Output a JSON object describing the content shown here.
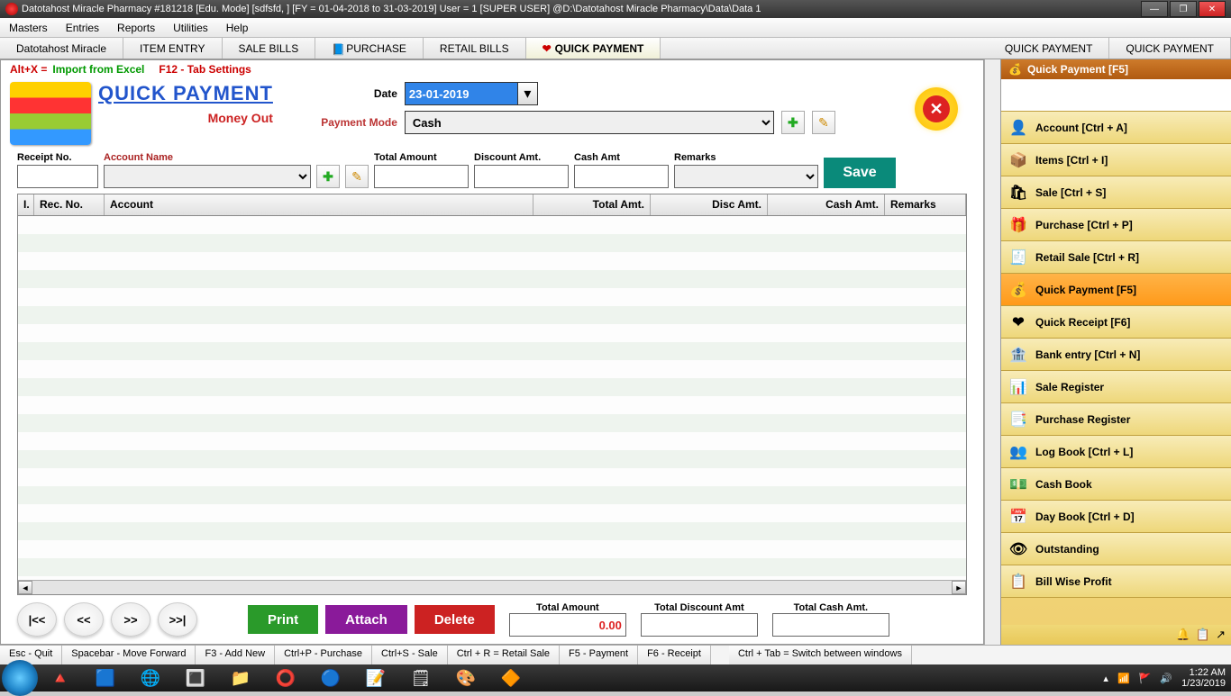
{
  "window": {
    "title": "Datotahost Miracle Pharmacy #181218  [Edu. Mode]  [sdfsfd, ] [FY = 01-04-2018 to 31-03-2019] User = 1 [SUPER USER]  @D:\\Datotahost Miracle Pharmacy\\Data\\Data 1"
  },
  "menubar": [
    "Masters",
    "Entries",
    "Reports",
    "Utilities",
    "Help"
  ],
  "apptabs": [
    {
      "label": "Datotahost Miracle"
    },
    {
      "label": "ITEM ENTRY"
    },
    {
      "label": "SALE BILLS"
    },
    {
      "label": "PURCHASE"
    },
    {
      "label": "RETAIL BILLS"
    },
    {
      "label": "QUICK PAYMENT",
      "active": true
    },
    {
      "label": "QUICK PAYMENT"
    },
    {
      "label": "QUICK PAYMENT"
    }
  ],
  "configbar": {
    "altx": "Alt+X =",
    "import": "Import from Excel",
    "f12": "F12 - Tab Settings"
  },
  "header": {
    "title": "QUICK PAYMENT",
    "subtitle": "Money Out",
    "date_label": "Date",
    "date_value": "23-01-2019",
    "pmode_label": "Payment Mode",
    "pmode_value": "Cash"
  },
  "entry": {
    "receipt_label": "Receipt No.",
    "account_label": "Account Name",
    "total_label": "Total Amount",
    "discount_label": "Discount Amt.",
    "cash_label": "Cash Amt",
    "remarks_label": "Remarks",
    "save": "Save"
  },
  "grid": {
    "cols": [
      "I.",
      "Rec. No.",
      "Account",
      "Total Amt.",
      "Disc Amt.",
      "Cash Amt.",
      "Remarks"
    ]
  },
  "nav": {
    "first": "|<<",
    "prev": "<<",
    "next": ">>",
    "last": ">>|"
  },
  "actions": {
    "print": "Print",
    "attach": "Attach",
    "delete": "Delete"
  },
  "totals": {
    "amount_label": "Total Amount",
    "amount_value": "0.00",
    "discount_label": "Total Discount Amt",
    "discount_value": "",
    "cash_label": "Total Cash Amt.",
    "cash_value": ""
  },
  "shortcuts": [
    "Esc - Quit",
    "Spacebar - Move Forward",
    "F3 - Add New",
    "Ctrl+P - Purchase",
    "Ctrl+S - Sale",
    "Ctrl + R = Retail Sale",
    "F5 - Payment",
    "F6 - Receipt",
    "Ctrl + Tab = Switch between windows"
  ],
  "side": {
    "title": "Quick Payment [F5]",
    "items": [
      {
        "label": "Account [Ctrl + A]",
        "icon": "👤"
      },
      {
        "label": "Items [Ctrl + I]",
        "icon": "📦"
      },
      {
        "label": "Sale [Ctrl + S]",
        "icon": "🛍"
      },
      {
        "label": "Purchase [Ctrl + P]",
        "icon": "🎁"
      },
      {
        "label": "Retail Sale [Ctrl + R]",
        "icon": "🧾"
      },
      {
        "label": "Quick Payment [F5]",
        "icon": "💰",
        "active": true
      },
      {
        "label": "Quick Receipt [F6]",
        "icon": "❤"
      },
      {
        "label": "Bank entry [Ctrl + N]",
        "icon": "🏦"
      },
      {
        "label": "Sale Register",
        "icon": "📊"
      },
      {
        "label": "Purchase Register",
        "icon": "📑"
      },
      {
        "label": "Log Book [Ctrl + L]",
        "icon": "👥"
      },
      {
        "label": "Cash Book",
        "icon": "💵"
      },
      {
        "label": "Day Book [Ctrl + D]",
        "icon": "📅"
      },
      {
        "label": "Outstanding",
        "icon": "👁"
      },
      {
        "label": "Bill Wise Profit",
        "icon": "📋"
      }
    ]
  },
  "tray": {
    "time": "1:22 AM",
    "date": "1/23/2019"
  }
}
